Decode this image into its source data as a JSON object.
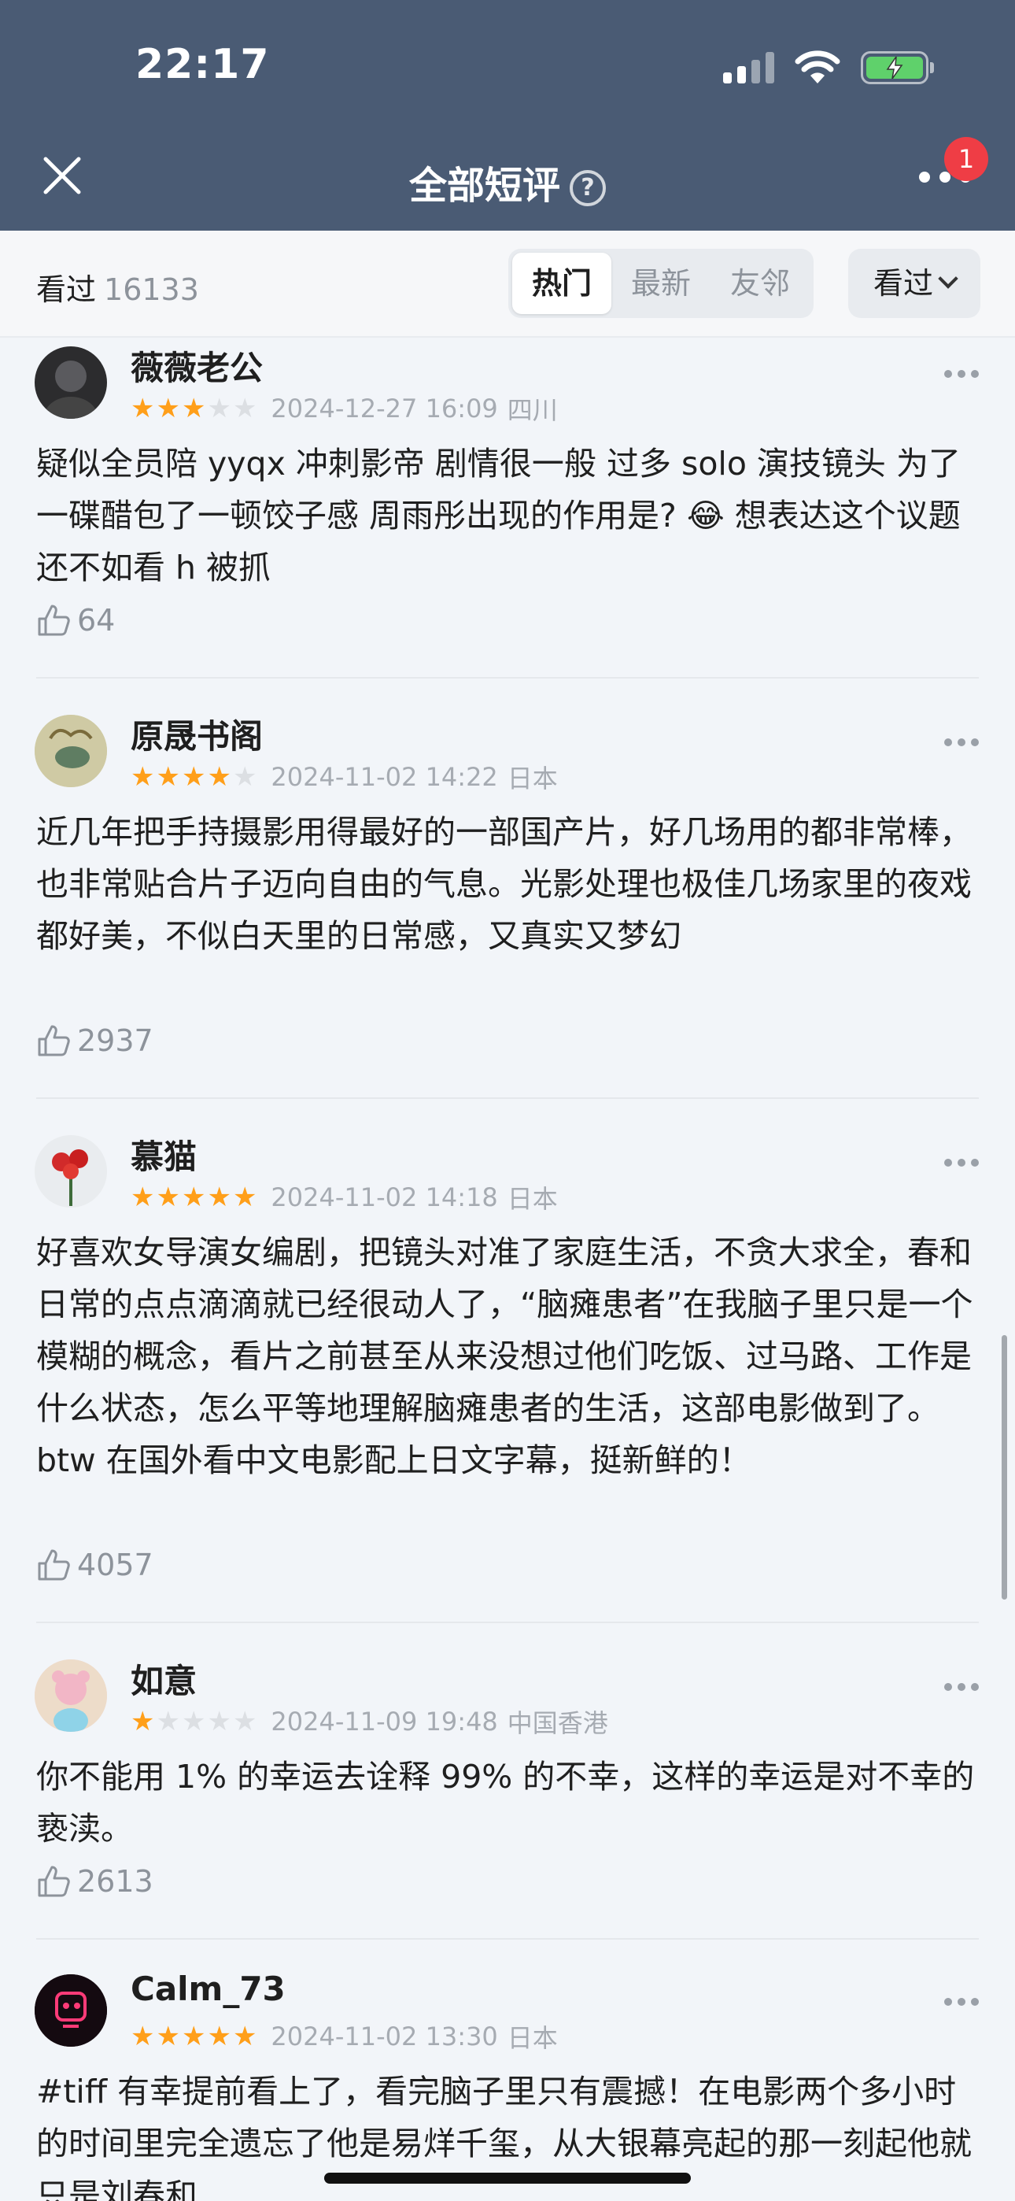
{
  "status_bar": {
    "time": "22:17"
  },
  "nav": {
    "title": "全部短评",
    "badge_count": "1"
  },
  "filter": {
    "seen_label": "看过",
    "seen_count": "16133",
    "tabs": [
      {
        "label": "热门",
        "active": true
      },
      {
        "label": "最新",
        "active": false
      },
      {
        "label": "友邻",
        "active": false
      }
    ],
    "dropdown_label": "看过"
  },
  "reviews": [
    {
      "author": "薇薇老公",
      "rating": 3,
      "date": "2024-12-27 16:09",
      "location": "四川",
      "text": "疑似全员陪 yyqx 冲刺影帝 剧情很一般 过多 solo 演技镜头 为了一碟醋包了一顿饺子感 周雨彤出现的作用是? 😂 想表达这个议题还不如看 h 被抓",
      "likes": "64",
      "avatar_icon": "dark-portrait-avatar"
    },
    {
      "author": "原晟书阁",
      "rating": 4,
      "date": "2024-11-02 14:22",
      "location": "日本",
      "text": "近几年把手持摄影用得最好的一部国产片，好几场用的都非常棒，也非常贴合片子迈向自由的气息。光影处理也极佳几场家里的夜戏都好美，不似白天里的日常感，又真实又梦幻",
      "likes": "2937",
      "avatar_icon": "painting-avatar"
    },
    {
      "author": "慕猫",
      "rating": 5,
      "date": "2024-11-02 14:18",
      "location": "日本",
      "text": "好喜欢女导演女编剧，把镜头对准了家庭生活，不贪大求全，春和日常的点点滴滴就已经很动人了，“脑瘫患者”在我脑子里只是一个模糊的概念，看片之前甚至从来没想过他们吃饭、过马路、工作是什么状态，怎么平等地理解脑瘫患者的生活，这部电影做到了。btw 在国外看中文电影配上日文字幕，挺新鲜的！",
      "likes": "4057",
      "avatar_icon": "red-flower-avatar"
    },
    {
      "author": "如意",
      "rating": 1,
      "date": "2024-11-09 19:48",
      "location": "中国香港",
      "text": "你不能用 1% 的幸运去诠释 99% 的不幸，这样的幸运是对不幸的亵渎。",
      "likes": "2613",
      "avatar_icon": "pink-bear-avatar"
    },
    {
      "author": "Calm_73",
      "rating": 5,
      "date": "2024-11-02 13:30",
      "location": "日本",
      "text": "#tiff 有幸提前看上了，看完脑子里只有震撼！在电影两个多小时的时间里完全遗忘了他是易烊千玺，从大银幕亮起的那一刻起他就只是刘春和",
      "likes": "",
      "avatar_icon": "neon-robot-avatar"
    }
  ],
  "colors": {
    "header_bg": "#4a5b74",
    "star_on": "#ff9f1a",
    "badge": "#ef3d45",
    "battery": "#5fd16b"
  }
}
